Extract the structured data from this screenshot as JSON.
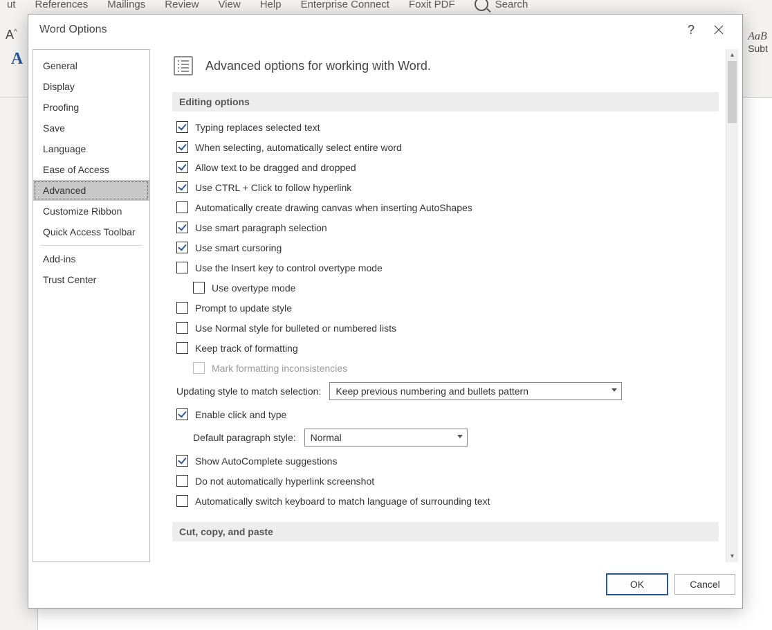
{
  "ribbon": {
    "tabs": [
      "ut",
      "References",
      "Mailings",
      "Review",
      "View",
      "Help",
      "Enterprise Connect",
      "Foxit PDF"
    ],
    "search_label": "Search"
  },
  "bg": {
    "format_a": "A",
    "style_sample": "AaB",
    "style_name": "Subt"
  },
  "dialog": {
    "title": "Word Options",
    "sidebar": {
      "items": [
        "General",
        "Display",
        "Proofing",
        "Save",
        "Language",
        "Ease of Access",
        "Advanced",
        "Customize Ribbon",
        "Quick Access Toolbar"
      ],
      "items2": [
        "Add-ins",
        "Trust Center"
      ],
      "selected_index": 6
    },
    "header": "Advanced options for working with Word.",
    "section1": "Editing options",
    "opts": {
      "typing_replaces": "Typing replaces selected text",
      "select_word": "When selecting, automatically select entire word",
      "drag_drop": "Allow text to be dragged and dropped",
      "ctrl_click": "Use CTRL + Click to follow hyperlink",
      "auto_canvas": "Automatically create drawing canvas when inserting AutoShapes",
      "smart_para": "Use smart paragraph selection",
      "smart_cursor": "Use smart cursoring",
      "insert_key": "Use the Insert key to control overtype mode",
      "overtype": "Use overtype mode",
      "prompt_style": "Prompt to update style",
      "normal_lists": "Use Normal style for bulleted or numbered lists",
      "track_fmt": "Keep track of formatting",
      "mark_fmt": "Mark formatting inconsistencies",
      "update_style_label": "Updating style to match selection:",
      "update_style_value": "Keep previous numbering and bullets pattern",
      "click_type": "Enable click and type",
      "default_para_label": "Default paragraph style:",
      "default_para_value": "Normal",
      "autocomplete": "Show AutoComplete suggestions",
      "no_hyperlink_ss": "Do not automatically hyperlink screenshot",
      "auto_kbd": "Automatically switch keyboard to match language of surrounding text"
    },
    "section2": "Cut, copy, and paste",
    "footer": {
      "ok": "OK",
      "cancel": "Cancel"
    }
  }
}
